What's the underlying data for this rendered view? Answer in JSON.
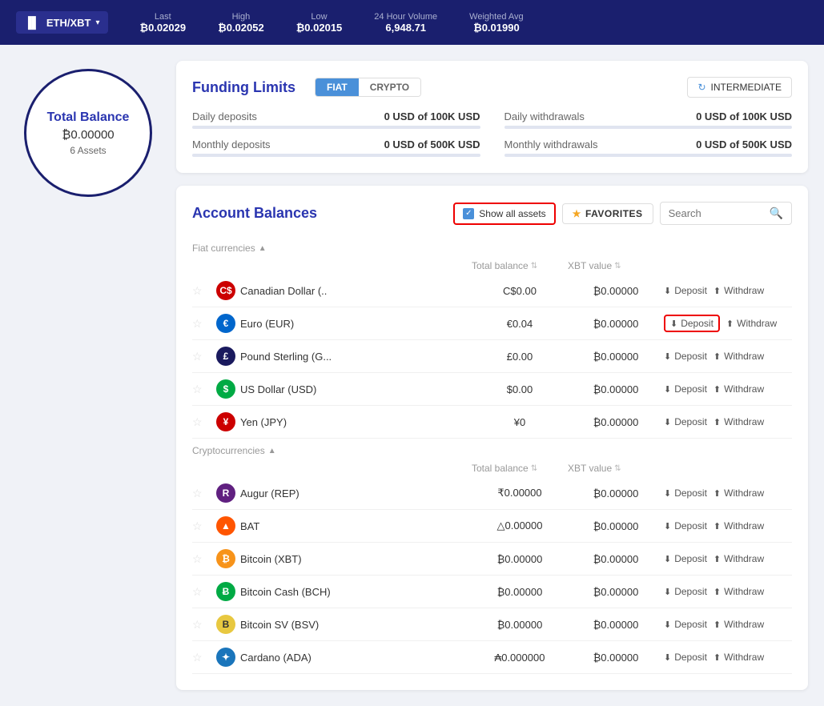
{
  "header": {
    "pair": "ETH/XBT",
    "last_label": "Last",
    "last_value": "₿0.02029",
    "high_label": "High",
    "high_value": "₿0.02052",
    "low_label": "Low",
    "low_value": "₿0.02015",
    "volume_label": "24 Hour Volume",
    "volume_value": "6,948.71",
    "weighted_label": "Weighted Avg",
    "weighted_value": "₿0.01990"
  },
  "balance": {
    "title": "Total Balance",
    "amount": "₿0.00000",
    "assets": "6 Assets"
  },
  "funding": {
    "title": "Funding Limits",
    "fiat_label": "FIAT",
    "crypto_label": "CRYPTO",
    "level_label": "INTERMEDIATE",
    "daily_deposits_label": "Daily deposits",
    "daily_deposits_value": "0 USD of 100K USD",
    "daily_withdrawals_label": "Daily withdrawals",
    "daily_withdrawals_value": "0 USD of 100K USD",
    "monthly_deposits_label": "Monthly deposits",
    "monthly_deposits_value": "0 USD of 500K USD",
    "monthly_withdrawals_label": "Monthly withdrawals",
    "monthly_withdrawals_value": "0 USD of 500K USD"
  },
  "balances": {
    "title": "Account Balances",
    "show_all_label": "Show all assets",
    "favorites_label": "FAVORITES",
    "search_placeholder": "Search",
    "fiat_section": "Fiat currencies",
    "crypto_section": "Cryptocurrencies",
    "col_total": "Total balance",
    "col_xbt": "XBT value",
    "fiat_currencies": [
      {
        "name": "Canadian Dollar (..",
        "icon_label": "C$",
        "icon_class": "icon-cad",
        "total": "C$0.00",
        "xbt": "₿0.00000",
        "deposit": "Deposit",
        "withdraw": "Withdraw",
        "deposit_highlight": false
      },
      {
        "name": "Euro (EUR)",
        "icon_label": "€",
        "icon_class": "icon-eur",
        "total": "€0.04",
        "xbt": "₿0.00000",
        "deposit": "Deposit",
        "withdraw": "Withdraw",
        "deposit_highlight": true
      },
      {
        "name": "Pound Sterling (G...",
        "icon_label": "£",
        "icon_class": "icon-gbp",
        "total": "£0.00",
        "xbt": "₿0.00000",
        "deposit": "Deposit",
        "withdraw": "Withdraw",
        "deposit_highlight": false
      },
      {
        "name": "US Dollar (USD)",
        "icon_label": "$",
        "icon_class": "icon-usd",
        "total": "$0.00",
        "xbt": "₿0.00000",
        "deposit": "Deposit",
        "withdraw": "Withdraw",
        "deposit_highlight": false
      },
      {
        "name": "Yen (JPY)",
        "icon_label": "¥",
        "icon_class": "icon-jpy",
        "total": "¥0",
        "xbt": "₿0.00000",
        "deposit": "Deposit",
        "withdraw": "Withdraw",
        "deposit_highlight": false
      }
    ],
    "cryptocurrencies": [
      {
        "name": "Augur (REP)",
        "icon_label": "R",
        "icon_class": "icon-rep",
        "total": "₹0.00000",
        "xbt": "₿0.00000",
        "deposit": "Deposit",
        "withdraw": "Withdraw",
        "deposit_highlight": false
      },
      {
        "name": "BAT",
        "icon_label": "▲",
        "icon_class": "icon-bat",
        "total": "△0.00000",
        "xbt": "₿0.00000",
        "deposit": "Deposit",
        "withdraw": "Withdraw",
        "deposit_highlight": false
      },
      {
        "name": "Bitcoin (XBT)",
        "icon_label": "₿",
        "icon_class": "icon-btc",
        "total": "₿0.00000",
        "xbt": "₿0.00000",
        "deposit": "Deposit",
        "withdraw": "Withdraw",
        "deposit_highlight": false
      },
      {
        "name": "Bitcoin Cash (BCH)",
        "icon_label": "Ƀ",
        "icon_class": "icon-bch",
        "total": "₿0.00000",
        "xbt": "₿0.00000",
        "deposit": "Deposit",
        "withdraw": "Withdraw",
        "deposit_highlight": false
      },
      {
        "name": "Bitcoin SV (BSV)",
        "icon_label": "B",
        "icon_class": "icon-bsv",
        "total": "₿0.00000",
        "xbt": "₿0.00000",
        "deposit": "Deposit",
        "withdraw": "Withdraw",
        "deposit_highlight": false
      },
      {
        "name": "Cardano (ADA)",
        "icon_label": "✦",
        "icon_class": "icon-ada",
        "total": "₳0.000000",
        "xbt": "₿0.00000",
        "deposit": "Deposit",
        "withdraw": "Withdraw",
        "deposit_highlight": false
      }
    ]
  }
}
